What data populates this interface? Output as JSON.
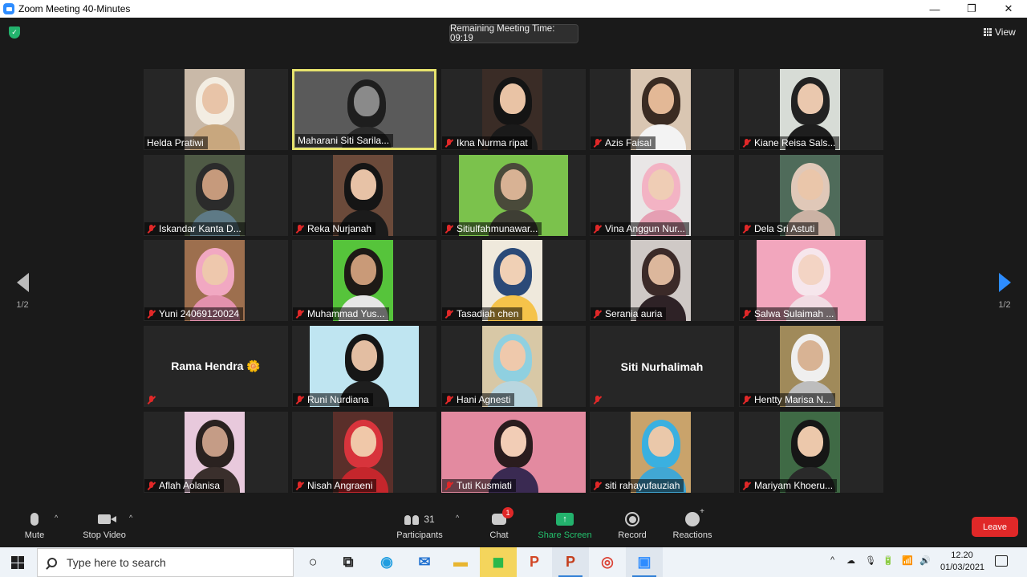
{
  "window": {
    "title": "Zoom Meeting 40-Minutes",
    "controls": [
      "—",
      "❐",
      "✕"
    ]
  },
  "meeting": {
    "timer": "Remaining Meeting Time: 09:19",
    "view_label": "View",
    "page_left": "1/2",
    "page_right": "1/2"
  },
  "participants_grid": [
    {
      "name": "Helda Pratiwi",
      "muted": false,
      "video": true,
      "active": false,
      "bg": "#c9b9a8",
      "skin": "#e8c4a8",
      "hijab": "#f3ede2",
      "clothes": "#c8a77e",
      "vleft": 51,
      "vwidth": 75
    },
    {
      "name": "Maharani Siti Sarila...",
      "muted": false,
      "video": true,
      "active": true,
      "bg": "#5a5a5a",
      "skin": "#8a8a8a",
      "hijab": "#1e1e1e",
      "clothes": "#2a2a2a",
      "vleft": 0,
      "vwidth": 180
    },
    {
      "name": "Ikna Nurma ripat",
      "muted": true,
      "video": true,
      "active": false,
      "bg": "#3a2c26",
      "skin": "#e9c3a5",
      "hijab": "#141414",
      "clothes": "#1a1a1a",
      "vleft": 51,
      "vwidth": 75
    },
    {
      "name": "Azis Faisal",
      "muted": true,
      "video": true,
      "active": false,
      "bg": "#d9c6b2",
      "skin": "#e3b896",
      "hijab": "#3a2b22",
      "clothes": "#f3f3f3",
      "vleft": 51,
      "vwidth": 75
    },
    {
      "name": "Kiane Reisa Sals...",
      "muted": true,
      "video": true,
      "active": false,
      "bg": "#d7dcd6",
      "skin": "#eac8ae",
      "hijab": "#222222",
      "clothes": "#1e1e1e",
      "vleft": 51,
      "vwidth": 75
    },
    {
      "name": "Iskandar Kanta D...",
      "muted": true,
      "video": true,
      "active": false,
      "bg": "#4f5a45",
      "skin": "#c69a7c",
      "hijab": "#2b2b2b",
      "clothes": "#5e7a86",
      "vleft": 51,
      "vwidth": 75
    },
    {
      "name": "Reka Nurjanah",
      "muted": true,
      "video": true,
      "active": false,
      "bg": "#6b4a3a",
      "skin": "#e7c2a6",
      "hijab": "#151515",
      "clothes": "#1b1b1b",
      "vleft": 51,
      "vwidth": 75
    },
    {
      "name": "Sitiulfahmunawar...",
      "muted": true,
      "video": true,
      "active": false,
      "bg": "#7bc24c",
      "skin": "#d8b294",
      "hijab": "#4a4a3a",
      "clothes": "#3e3e34",
      "vleft": 22,
      "vwidth": 136
    },
    {
      "name": "Vina Anggun Nur...",
      "muted": true,
      "video": true,
      "active": false,
      "bg": "#e9e6e6",
      "skin": "#efcdb5",
      "hijab": "#f3b3c4",
      "clothes": "#e59fb3",
      "vleft": 51,
      "vwidth": 75
    },
    {
      "name": "Dela Sri Astuti",
      "muted": true,
      "video": true,
      "active": false,
      "bg": "#4f6b5a",
      "skin": "#eac6aa",
      "hijab": "#e0c8b8",
      "clothes": "#cbb2a4",
      "vleft": 51,
      "vwidth": 75
    },
    {
      "name": "Yuni 24069120024",
      "muted": true,
      "video": true,
      "active": false,
      "bg": "#9d6f4e",
      "skin": "#eec8ad",
      "hijab": "#f1a8c2",
      "clothes": "#e391ad",
      "vleft": 51,
      "vwidth": 75
    },
    {
      "name": "Muhammad Yus...",
      "muted": true,
      "video": true,
      "active": false,
      "bg": "#56c43b",
      "skin": "#c99a78",
      "hijab": "#1e1a16",
      "clothes": "#e6e6e6",
      "vleft": 51,
      "vwidth": 75
    },
    {
      "name": "Tasadiah chen",
      "muted": true,
      "video": true,
      "active": false,
      "bg": "#efe9dc",
      "skin": "#f0d0b5",
      "hijab": "#2b4a78",
      "clothes": "#f5c34a",
      "vleft": 51,
      "vwidth": 75
    },
    {
      "name": "Serania auria",
      "muted": true,
      "video": true,
      "active": false,
      "bg": "#cfc9c6",
      "skin": "#dcb79c",
      "hijab": "#3b2a28",
      "clothes": "#2e2226",
      "vleft": 51,
      "vwidth": 75
    },
    {
      "name": "Salwa Sulaimah ...",
      "muted": true,
      "video": true,
      "active": false,
      "bg": "#f2a6bd",
      "skin": "#f3d4c4",
      "hijab": "#f6e6ec",
      "clothes": "#f1dce3",
      "vleft": 22,
      "vwidth": 136
    },
    {
      "name": "Rama  Hendra 🌼",
      "muted": true,
      "video": false,
      "active": false
    },
    {
      "name": "Runi Nurdiana",
      "muted": true,
      "video": true,
      "active": false,
      "bg": "#bfe5f1",
      "skin": "#e3bea2",
      "hijab": "#161616",
      "clothes": "#1e1e1e",
      "vleft": 22,
      "vwidth": 136
    },
    {
      "name": "Hani Agnesti",
      "muted": true,
      "video": true,
      "active": false,
      "bg": "#d8c8a6",
      "skin": "#efc9ac",
      "hijab": "#8fd0e0",
      "clothes": "#b9d6df",
      "vleft": 51,
      "vwidth": 75
    },
    {
      "name": "Siti Nurhalimah",
      "muted": true,
      "video": false,
      "active": false
    },
    {
      "name": "Hentty Marisa N...",
      "muted": true,
      "video": true,
      "active": false,
      "bg": "#a08a5a",
      "skin": "#d8b394",
      "hijab": "#efefef",
      "clothes": "#bdbdbd",
      "vleft": 51,
      "vwidth": 75
    },
    {
      "name": "Aflah Aolanisa",
      "muted": true,
      "video": true,
      "active": false,
      "bg": "#e8c9dc",
      "skin": "#c59c86",
      "hijab": "#2a2220",
      "clothes": "#3a2f2c",
      "vleft": 51,
      "vwidth": 75
    },
    {
      "name": "Nisah Angraeni",
      "muted": true,
      "video": true,
      "active": false,
      "bg": "#5a2f2a",
      "skin": "#f0c8a9",
      "hijab": "#d8343c",
      "clothes": "#c5262c",
      "vleft": 51,
      "vwidth": 75
    },
    {
      "name": "Tuti Kusmiati",
      "muted": true,
      "video": true,
      "active": false,
      "bg": "#e38aa0",
      "skin": "#f2cdb6",
      "hijab": "#2a1c1e",
      "clothes": "#3a2a52",
      "vleft": 0,
      "vwidth": 180
    },
    {
      "name": "siti rahayufauziah",
      "muted": true,
      "video": true,
      "active": false,
      "bg": "#c9a36b",
      "skin": "#eac8aa",
      "hijab": "#3ab0e0",
      "clothes": "#41a7d4",
      "vleft": 51,
      "vwidth": 75
    },
    {
      "name": "Mariyam Khoeru...",
      "muted": true,
      "video": true,
      "active": false,
      "bg": "#3f6a45",
      "skin": "#ecc8ab",
      "hijab": "#161616",
      "clothes": "#2a2a2a",
      "vleft": 51,
      "vwidth": 75
    }
  ],
  "toolbar": {
    "mute": "Mute",
    "stop_video": "Stop Video",
    "participants": "Participants",
    "participants_count": "31",
    "chat": "Chat",
    "chat_badge": "1",
    "share_screen": "Share Screen",
    "record": "Record",
    "reactions": "Reactions",
    "leave": "Leave",
    "caret": "^"
  },
  "taskbar": {
    "search_placeholder": "Type here to search",
    "apps": [
      {
        "name": "task-view",
        "glyph": "○",
        "color": "#222",
        "active": false,
        "hl": false
      },
      {
        "name": "multitask",
        "glyph": "⧉",
        "color": "#222",
        "active": false,
        "hl": false
      },
      {
        "name": "edge",
        "glyph": "◉",
        "color": "#1f9de0",
        "active": false,
        "hl": false
      },
      {
        "name": "mail",
        "glyph": "✉",
        "color": "#1e6fd0",
        "active": false,
        "hl": false
      },
      {
        "name": "file-explorer",
        "glyph": "▬",
        "color": "#e8b530",
        "active": false,
        "hl": false
      },
      {
        "name": "line",
        "glyph": "◼",
        "color": "#2cb84a",
        "active": false,
        "hl": true
      },
      {
        "name": "powerpoint",
        "glyph": "P",
        "color": "#d24726",
        "active": false,
        "hl": false
      },
      {
        "name": "powerpoint-2",
        "glyph": "P",
        "color": "#c43e1c",
        "active": true,
        "hl": false
      },
      {
        "name": "chrome",
        "glyph": "◎",
        "color": "#db4437",
        "active": false,
        "hl": false
      },
      {
        "name": "zoom",
        "glyph": "▣",
        "color": "#2d8cff",
        "active": true,
        "hl": false
      }
    ],
    "tray": [
      "^",
      "☁",
      "🎙",
      "🔋",
      "📶",
      "🔊"
    ],
    "time": "12.20",
    "date": "01/03/2021"
  }
}
